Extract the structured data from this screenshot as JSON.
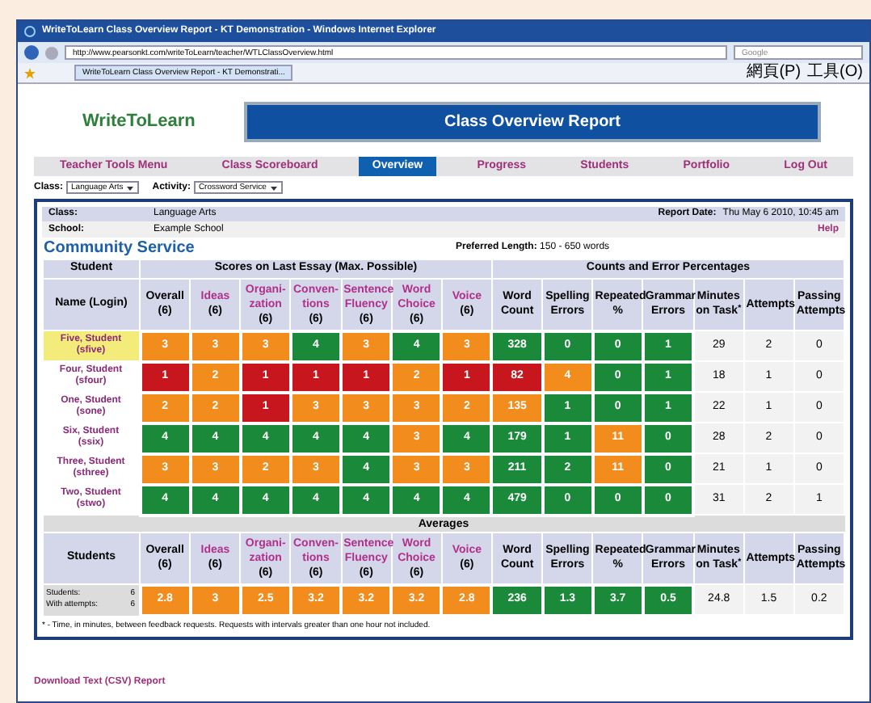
{
  "window": {
    "title": "WriteToLearn Class Overview Report - KT Demonstration - Windows Internet Explorer"
  },
  "browser": {
    "address": "http://www.pearsonkt.com/writeToLearn/teacher/WTLClassOverview.html",
    "search_placeholder": "Google",
    "tab": "WriteToLearn Class Overview Report - KT Demonstrati...",
    "menu_items": [
      "網頁(P)",
      "工具(O)"
    ]
  },
  "logo": "WriteToLearn",
  "header": "Class Overview Report",
  "nav": [
    {
      "label": "Teacher Tools Menu",
      "selected": false
    },
    {
      "label": "Class Scoreboard",
      "selected": false
    },
    {
      "label": "Overview",
      "selected": true
    },
    {
      "label": "Progress",
      "selected": false
    },
    {
      "label": "Students",
      "selected": false
    },
    {
      "label": "Portfolio",
      "selected": false
    },
    {
      "label": "Log Out",
      "selected": false
    }
  ],
  "filters": [
    {
      "label": "Class:",
      "value": "Language Arts"
    },
    {
      "label": "Activity:",
      "value": "Crossword Service"
    }
  ],
  "info": {
    "class_label": "Class:",
    "class_value": "Language Arts",
    "date_label": "Report Date:",
    "date_value": "Thu May 6 2010, 10:45 am",
    "school_label": "School:",
    "school_value": "Example School",
    "help": "Help"
  },
  "activity": {
    "title": "Community Service",
    "length_label": "Preferred Length:",
    "length_value": "150 - 650 words"
  },
  "groups": [
    "Student",
    "Scores on Last Essay (Max. Possible)",
    "Counts and Error Percentages"
  ],
  "name_header": "Name (Login)",
  "columns": [
    {
      "label": "Overall",
      "max": "(6)",
      "kind": "total"
    },
    {
      "label": "Ideas",
      "max": "(6)",
      "kind": "trait"
    },
    {
      "label": "Organi-\nzation",
      "max": "(6)",
      "kind": "trait"
    },
    {
      "label": "Conven-\ntions",
      "max": "(6)",
      "kind": "trait"
    },
    {
      "label": "Sentence\nFluency",
      "max": "(6)",
      "kind": "trait"
    },
    {
      "label": "Word\nChoice",
      "max": "(6)",
      "kind": "trait"
    },
    {
      "label": "Voice",
      "max": "(6)",
      "kind": "trait"
    },
    {
      "label": "Word\nCount",
      "kind": "count"
    },
    {
      "label": "Spelling\nErrors",
      "kind": "count"
    },
    {
      "label": "Repeated\n%",
      "kind": "count"
    },
    {
      "label": "Grammar\nErrors",
      "kind": "count"
    },
    {
      "label": "Minutes\non Task$^{*}$",
      "kind": "count"
    },
    {
      "label": "Attempts",
      "kind": "count"
    },
    {
      "label": "Passing\nAttempts",
      "kind": "count"
    }
  ],
  "rows": [
    {
      "name": "Five, Student",
      "login": "(sfive)",
      "selected": true,
      "cells": [
        {
          "value": "3",
          "color": "#f28c1c"
        },
        {
          "value": "3",
          "color": "#f28c1c"
        },
        {
          "value": "3",
          "color": "#f28c1c"
        },
        {
          "value": "4",
          "color": "#1a8a3a"
        },
        {
          "value": "3",
          "color": "#f28c1c"
        },
        {
          "value": "4",
          "color": "#1a8a3a"
        },
        {
          "value": "3",
          "color": "#f28c1c"
        },
        {
          "value": "328",
          "color": "#1a8a3a"
        },
        {
          "value": "0",
          "color": "#1a8a3a"
        },
        {
          "value": "0",
          "color": "#1a8a3a"
        },
        {
          "value": "1",
          "color": "#1a8a3a"
        }
      ],
      "plain": [
        "29",
        "2",
        "0"
      ]
    },
    {
      "name": "Four, Student",
      "login": "(sfour)",
      "selected": false,
      "cells": [
        {
          "value": "1",
          "color": "#c8161e"
        },
        {
          "value": "2",
          "color": "#f28c1c"
        },
        {
          "value": "1",
          "color": "#c8161e"
        },
        {
          "value": "1",
          "color": "#c8161e"
        },
        {
          "value": "1",
          "color": "#c8161e"
        },
        {
          "value": "2",
          "color": "#f28c1c"
        },
        {
          "value": "1",
          "color": "#c8161e"
        },
        {
          "value": "82",
          "color": "#c8161e"
        },
        {
          "value": "4",
          "color": "#f28c1c"
        },
        {
          "value": "0",
          "color": "#1a8a3a"
        },
        {
          "value": "1",
          "color": "#1a8a3a"
        }
      ],
      "plain": [
        "18",
        "1",
        "0"
      ]
    },
    {
      "name": "One, Student",
      "login": "(sone)",
      "selected": false,
      "cells": [
        {
          "value": "2",
          "color": "#f28c1c"
        },
        {
          "value": "2",
          "color": "#f28c1c"
        },
        {
          "value": "1",
          "color": "#c8161e"
        },
        {
          "value": "3",
          "color": "#f28c1c"
        },
        {
          "value": "3",
          "color": "#f28c1c"
        },
        {
          "value": "3",
          "color": "#f28c1c"
        },
        {
          "value": "2",
          "color": "#f28c1c"
        },
        {
          "value": "135",
          "color": "#f28c1c"
        },
        {
          "value": "1",
          "color": "#1a8a3a"
        },
        {
          "value": "0",
          "color": "#1a8a3a"
        },
        {
          "value": "1",
          "color": "#1a8a3a"
        }
      ],
      "plain": [
        "22",
        "1",
        "0"
      ]
    },
    {
      "name": "Six, Student",
      "login": "(ssix)",
      "selected": false,
      "cells": [
        {
          "value": "4",
          "color": "#1a8a3a"
        },
        {
          "value": "4",
          "color": "#1a8a3a"
        },
        {
          "value": "4",
          "color": "#1a8a3a"
        },
        {
          "value": "4",
          "color": "#1a8a3a"
        },
        {
          "value": "4",
          "color": "#1a8a3a"
        },
        {
          "value": "3",
          "color": "#f28c1c"
        },
        {
          "value": "4",
          "color": "#1a8a3a"
        },
        {
          "value": "179",
          "color": "#1a8a3a"
        },
        {
          "value": "1",
          "color": "#1a8a3a"
        },
        {
          "value": "11",
          "color": "#f28c1c"
        },
        {
          "value": "0",
          "color": "#1a8a3a"
        }
      ],
      "plain": [
        "28",
        "2",
        "0"
      ]
    },
    {
      "name": "Three, Student",
      "login": "(sthree)",
      "selected": false,
      "cells": [
        {
          "value": "3",
          "color": "#f28c1c"
        },
        {
          "value": "3",
          "color": "#f28c1c"
        },
        {
          "value": "2",
          "color": "#f28c1c"
        },
        {
          "value": "3",
          "color": "#f28c1c"
        },
        {
          "value": "4",
          "color": "#1a8a3a"
        },
        {
          "value": "3",
          "color": "#f28c1c"
        },
        {
          "value": "3",
          "color": "#f28c1c"
        },
        {
          "value": "211",
          "color": "#1a8a3a"
        },
        {
          "value": "2",
          "color": "#1a8a3a"
        },
        {
          "value": "11",
          "color": "#f28c1c"
        },
        {
          "value": "0",
          "color": "#1a8a3a"
        }
      ],
      "plain": [
        "21",
        "1",
        "0"
      ]
    },
    {
      "name": "Two, Student",
      "login": "(stwo)",
      "selected": false,
      "cells": [
        {
          "value": "4",
          "color": "#1a8a3a"
        },
        {
          "value": "4",
          "color": "#1a8a3a"
        },
        {
          "value": "4",
          "color": "#1a8a3a"
        },
        {
          "value": "4",
          "color": "#1a8a3a"
        },
        {
          "value": "4",
          "color": "#1a8a3a"
        },
        {
          "value": "4",
          "color": "#1a8a3a"
        },
        {
          "value": "4",
          "color": "#1a8a3a"
        },
        {
          "value": "479",
          "color": "#1a8a3a"
        },
        {
          "value": "0",
          "color": "#1a8a3a"
        },
        {
          "value": "0",
          "color": "#1a8a3a"
        },
        {
          "value": "0",
          "color": "#1a8a3a"
        }
      ],
      "plain": [
        "31",
        "2",
        "1"
      ]
    }
  ],
  "averages": {
    "title": "Averages",
    "students_header": "Students",
    "columns": [
      {
        "label": "Overall",
        "max": "(6)",
        "kind": "total"
      },
      {
        "label": "Ideas",
        "max": "(6)",
        "kind": "trait"
      },
      {
        "label": "Organi-\nzation",
        "max": "(6)",
        "kind": "trait"
      },
      {
        "label": "Conven-\ntions",
        "max": "(6)",
        "kind": "trait"
      },
      {
        "label": "Sentence\nFluency",
        "max": "(6)",
        "kind": "trait"
      },
      {
        "label": "Word\nChoice",
        "max": "(6)",
        "kind": "trait"
      },
      {
        "label": "Voice",
        "max": "(6)",
        "kind": "trait"
      },
      {
        "label": "Word\nCount",
        "kind": "count"
      },
      {
        "label": "Spelling\nErrors",
        "kind": "count"
      },
      {
        "label": "Repeated\n%",
        "kind": "count"
      },
      {
        "label": "Grammar\nErrors",
        "kind": "count"
      },
      {
        "label": "Minutes\non Task$^{*}$",
        "kind": "count"
      },
      {
        "label": "Attempts",
        "kind": "count"
      },
      {
        "label": "Passing\nAttempts",
        "kind": "count"
      }
    ],
    "summary": [
      {
        "label": "Students:",
        "value": "6"
      },
      {
        "label": "With attempts:",
        "value": "6"
      }
    ],
    "cells": [
      {
        "value": "2.8",
        "color": "#f28c1c"
      },
      {
        "value": "3",
        "color": "#f28c1c"
      },
      {
        "value": "2.5",
        "color": "#f28c1c"
      },
      {
        "value": "3.2",
        "color": "#f28c1c"
      },
      {
        "value": "3.2",
        "color": "#f28c1c"
      },
      {
        "value": "3.2",
        "color": "#f28c1c"
      },
      {
        "value": "2.8",
        "color": "#f28c1c"
      },
      {
        "value": "236",
        "color": "#1a8a3a"
      },
      {
        "value": "1.3",
        "color": "#1a8a3a"
      },
      {
        "value": "3.7",
        "color": "#1a8a3a"
      },
      {
        "value": "0.5",
        "color": "#1a8a3a"
      }
    ],
    "plain": [
      "24.8",
      "1.5",
      "0.2"
    ]
  },
  "footnote": "* - Time, in minutes, between feedback requests. Requests with intervals greater than one hour not included.",
  "download": "Download Text (CSV) Report"
}
